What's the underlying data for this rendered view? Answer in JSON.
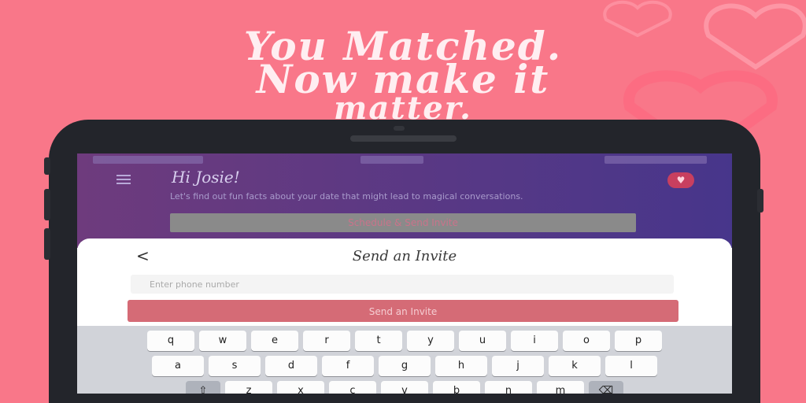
{
  "headline": {
    "line1": "You Matched.",
    "line2": "Now make it",
    "line3": "matter."
  },
  "colors": {
    "background": "#f97789",
    "accent": "#d56b76",
    "header_gradient_start": "#6e3b7d",
    "header_gradient_end": "#47368b"
  },
  "app_header": {
    "greeting": "Hi Josie!",
    "description": "Let's find out fun facts about your date that might lead to magical conversations.",
    "schedule_button": "Schedule & Send Invite",
    "heart_icon": "heart-icon",
    "menu_icon": "menu-icon"
  },
  "sheet": {
    "back_icon": "back-arrow-icon",
    "back_label": "<",
    "title": "Send an Invite",
    "phone_placeholder": "Enter phone number",
    "phone_value": "",
    "send_button": "Send an Invite"
  },
  "keyboard": {
    "row1": [
      "q",
      "w",
      "e",
      "r",
      "t",
      "y",
      "u",
      "i",
      "o",
      "p"
    ],
    "row2": [
      "a",
      "s",
      "d",
      "f",
      "g",
      "h",
      "j",
      "k",
      "l"
    ],
    "row3": [
      "⇧",
      "z",
      "x",
      "c",
      "v",
      "b",
      "n",
      "m",
      "⌫"
    ]
  }
}
